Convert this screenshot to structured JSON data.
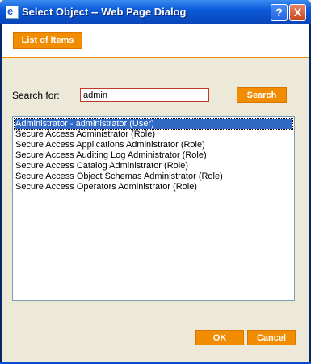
{
  "window": {
    "title": "Select Object -- Web Page Dialog",
    "help_label": "?",
    "close_label": "X",
    "icon": "ie-page-icon"
  },
  "header": {
    "tab_label": "List of Items"
  },
  "search": {
    "label": "Search for:",
    "value": "admin",
    "button_label": "Search"
  },
  "results": {
    "items": [
      {
        "label": "Administrator - administrator (User)",
        "selected": true
      },
      {
        "label": "Secure Access Administrator (Role)",
        "selected": false
      },
      {
        "label": "Secure Access Applications Administrator (Role)",
        "selected": false
      },
      {
        "label": "Secure Access Auditing Log Administrator (Role)",
        "selected": false
      },
      {
        "label": "Secure Access Catalog Administrator (Role)",
        "selected": false
      },
      {
        "label": "Secure Access Object Schemas Administrator (Role)",
        "selected": false
      },
      {
        "label": "Secure Access Operators Administrator (Role)",
        "selected": false
      }
    ]
  },
  "footer": {
    "ok_label": "OK",
    "cancel_label": "Cancel"
  },
  "colors": {
    "accent": "#F28C00",
    "titlebar": "#0A4FC9",
    "selection": "#316AC5",
    "dialog_bg": "#ECE9D8"
  }
}
